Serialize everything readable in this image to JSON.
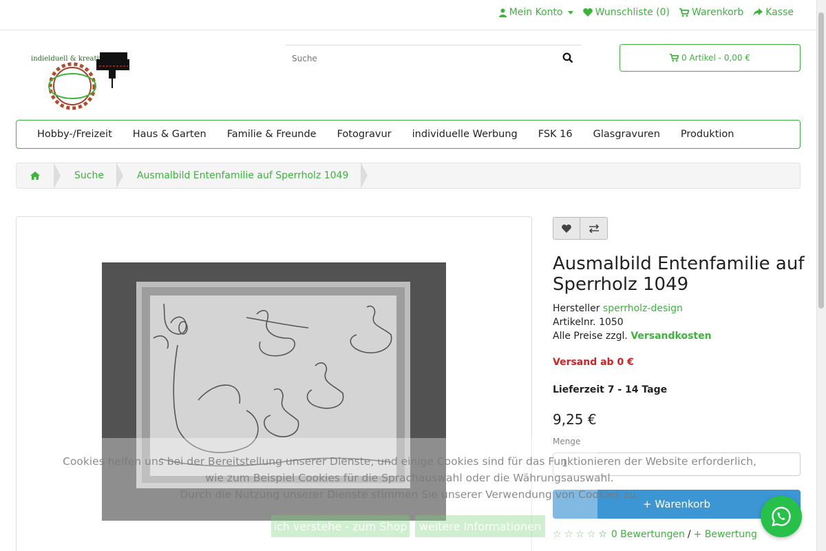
{
  "topbar": {
    "account": "Mein Konto",
    "wishlist": "Wunschliste (0)",
    "cart": "Warenkorb",
    "checkout": "Kasse"
  },
  "logo": {
    "text": "indielduell & kreativ"
  },
  "search": {
    "placeholder": "Suche"
  },
  "header_cart": {
    "label": "0 Artikel - 0,00 €"
  },
  "nav": {
    "items": [
      "Hobby-/Freizeit",
      "Haus & Garten",
      "Familie & Freunde",
      "Fotogravur",
      "individuelle Werbung",
      "FSK 16",
      "Glasgravuren",
      "Produktion"
    ]
  },
  "breadcrumb": {
    "items": [
      "Suche",
      "Ausmalbild Entenfamilie auf Sperrholz 1049"
    ]
  },
  "product": {
    "title": "Ausmalbild Entenfamilie auf Sperrholz 1049",
    "manufacturer_label": "Hersteller",
    "manufacturer": "sperrholz-design",
    "sku_label": "Artikelnr.",
    "sku": "1050",
    "prices_note": "Alle Preise zzgl.",
    "shipping_link": "Versandkosten",
    "shipping_from": "Versand ab 0 €",
    "delivery": "Lieferzeit 7 - 14 Tage",
    "price": "9,25 €",
    "qty_label": "Menge",
    "qty_value": "1",
    "add_to_cart": "+ Warenkorb",
    "reviews_count": "0 Bewertungen",
    "separator": "/",
    "add_review": "+ Bewertung",
    "rating": 0
  },
  "cookie": {
    "line1": "Cookies helfen uns bei der Bereitstellung unserer Dienste, und einige Cookies sind für das Funktionieren der Website erforderlich,",
    "line2": "wie zum Beispiel Cookies für die Sprachauswahl oder die Währungsauswahl.",
    "line3": "Durch die Nutzung unserer Dienste stimmen Sie unserer Verwendung von Cookies zu.",
    "accept": "ich verstehe - zum Shop",
    "more": "weitere Informationen"
  },
  "colors": {
    "accent": "#3cb43c",
    "cart_button": "#3c96d4",
    "shipping_red": "#d42020",
    "whatsapp": "#27c14a"
  }
}
